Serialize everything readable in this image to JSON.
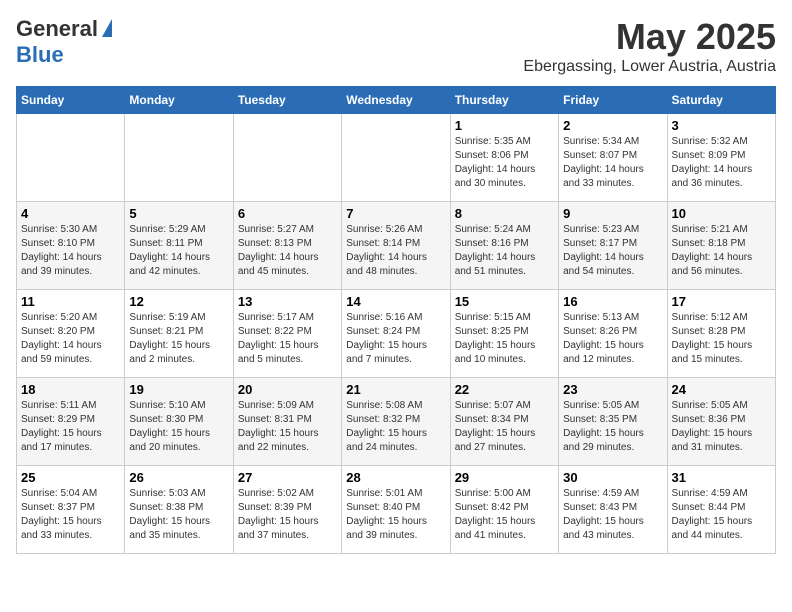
{
  "header": {
    "logo_general": "General",
    "logo_blue": "Blue",
    "month_title": "May 2025",
    "location": "Ebergassing, Lower Austria, Austria"
  },
  "days_of_week": [
    "Sunday",
    "Monday",
    "Tuesday",
    "Wednesday",
    "Thursday",
    "Friday",
    "Saturday"
  ],
  "weeks": [
    [
      {
        "day": "",
        "info": ""
      },
      {
        "day": "",
        "info": ""
      },
      {
        "day": "",
        "info": ""
      },
      {
        "day": "",
        "info": ""
      },
      {
        "day": "1",
        "info": "Sunrise: 5:35 AM\nSunset: 8:06 PM\nDaylight: 14 hours\nand 30 minutes."
      },
      {
        "day": "2",
        "info": "Sunrise: 5:34 AM\nSunset: 8:07 PM\nDaylight: 14 hours\nand 33 minutes."
      },
      {
        "day": "3",
        "info": "Sunrise: 5:32 AM\nSunset: 8:09 PM\nDaylight: 14 hours\nand 36 minutes."
      }
    ],
    [
      {
        "day": "4",
        "info": "Sunrise: 5:30 AM\nSunset: 8:10 PM\nDaylight: 14 hours\nand 39 minutes."
      },
      {
        "day": "5",
        "info": "Sunrise: 5:29 AM\nSunset: 8:11 PM\nDaylight: 14 hours\nand 42 minutes."
      },
      {
        "day": "6",
        "info": "Sunrise: 5:27 AM\nSunset: 8:13 PM\nDaylight: 14 hours\nand 45 minutes."
      },
      {
        "day": "7",
        "info": "Sunrise: 5:26 AM\nSunset: 8:14 PM\nDaylight: 14 hours\nand 48 minutes."
      },
      {
        "day": "8",
        "info": "Sunrise: 5:24 AM\nSunset: 8:16 PM\nDaylight: 14 hours\nand 51 minutes."
      },
      {
        "day": "9",
        "info": "Sunrise: 5:23 AM\nSunset: 8:17 PM\nDaylight: 14 hours\nand 54 minutes."
      },
      {
        "day": "10",
        "info": "Sunrise: 5:21 AM\nSunset: 8:18 PM\nDaylight: 14 hours\nand 56 minutes."
      }
    ],
    [
      {
        "day": "11",
        "info": "Sunrise: 5:20 AM\nSunset: 8:20 PM\nDaylight: 14 hours\nand 59 minutes."
      },
      {
        "day": "12",
        "info": "Sunrise: 5:19 AM\nSunset: 8:21 PM\nDaylight: 15 hours\nand 2 minutes."
      },
      {
        "day": "13",
        "info": "Sunrise: 5:17 AM\nSunset: 8:22 PM\nDaylight: 15 hours\nand 5 minutes."
      },
      {
        "day": "14",
        "info": "Sunrise: 5:16 AM\nSunset: 8:24 PM\nDaylight: 15 hours\nand 7 minutes."
      },
      {
        "day": "15",
        "info": "Sunrise: 5:15 AM\nSunset: 8:25 PM\nDaylight: 15 hours\nand 10 minutes."
      },
      {
        "day": "16",
        "info": "Sunrise: 5:13 AM\nSunset: 8:26 PM\nDaylight: 15 hours\nand 12 minutes."
      },
      {
        "day": "17",
        "info": "Sunrise: 5:12 AM\nSunset: 8:28 PM\nDaylight: 15 hours\nand 15 minutes."
      }
    ],
    [
      {
        "day": "18",
        "info": "Sunrise: 5:11 AM\nSunset: 8:29 PM\nDaylight: 15 hours\nand 17 minutes."
      },
      {
        "day": "19",
        "info": "Sunrise: 5:10 AM\nSunset: 8:30 PM\nDaylight: 15 hours\nand 20 minutes."
      },
      {
        "day": "20",
        "info": "Sunrise: 5:09 AM\nSunset: 8:31 PM\nDaylight: 15 hours\nand 22 minutes."
      },
      {
        "day": "21",
        "info": "Sunrise: 5:08 AM\nSunset: 8:32 PM\nDaylight: 15 hours\nand 24 minutes."
      },
      {
        "day": "22",
        "info": "Sunrise: 5:07 AM\nSunset: 8:34 PM\nDaylight: 15 hours\nand 27 minutes."
      },
      {
        "day": "23",
        "info": "Sunrise: 5:05 AM\nSunset: 8:35 PM\nDaylight: 15 hours\nand 29 minutes."
      },
      {
        "day": "24",
        "info": "Sunrise: 5:05 AM\nSunset: 8:36 PM\nDaylight: 15 hours\nand 31 minutes."
      }
    ],
    [
      {
        "day": "25",
        "info": "Sunrise: 5:04 AM\nSunset: 8:37 PM\nDaylight: 15 hours\nand 33 minutes."
      },
      {
        "day": "26",
        "info": "Sunrise: 5:03 AM\nSunset: 8:38 PM\nDaylight: 15 hours\nand 35 minutes."
      },
      {
        "day": "27",
        "info": "Sunrise: 5:02 AM\nSunset: 8:39 PM\nDaylight: 15 hours\nand 37 minutes."
      },
      {
        "day": "28",
        "info": "Sunrise: 5:01 AM\nSunset: 8:40 PM\nDaylight: 15 hours\nand 39 minutes."
      },
      {
        "day": "29",
        "info": "Sunrise: 5:00 AM\nSunset: 8:42 PM\nDaylight: 15 hours\nand 41 minutes."
      },
      {
        "day": "30",
        "info": "Sunrise: 4:59 AM\nSunset: 8:43 PM\nDaylight: 15 hours\nand 43 minutes."
      },
      {
        "day": "31",
        "info": "Sunrise: 4:59 AM\nSunset: 8:44 PM\nDaylight: 15 hours\nand 44 minutes."
      }
    ]
  ]
}
